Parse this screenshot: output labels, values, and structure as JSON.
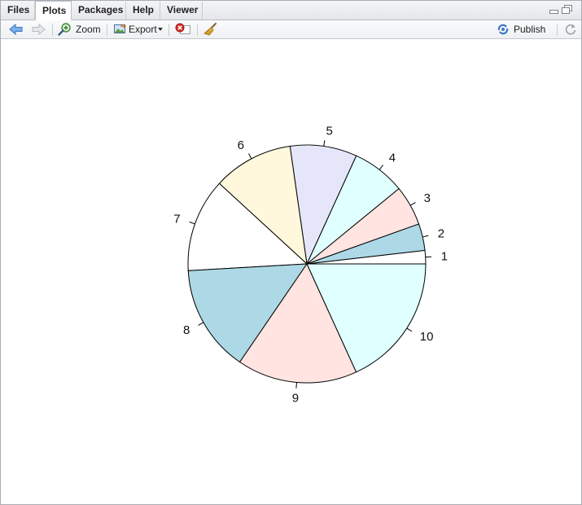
{
  "tabs": [
    {
      "label": "Files"
    },
    {
      "label": "Plots"
    },
    {
      "label": "Packages"
    },
    {
      "label": "Help"
    },
    {
      "label": "Viewer"
    }
  ],
  "active_tab": "Plots",
  "toolbar": {
    "back_icon": "arrow-left-icon",
    "forward_icon": "arrow-right-icon",
    "zoom_label": "Zoom",
    "export_label": "Export",
    "remove_icon": "remove-plot-icon",
    "clear_icon": "broom-icon",
    "publish_label": "Publish",
    "refresh_icon": "refresh-icon"
  },
  "colors": {
    "slices": [
      "#ffffff",
      "#add8e6",
      "#ffe4e1",
      "#e0ffff",
      "#e6e6fa",
      "#fff8dc",
      "#ffffff",
      "#add8e6",
      "#ffe4e1",
      "#e0ffff"
    ],
    "accent": "#3a78c3"
  },
  "chart_data": {
    "type": "pie",
    "title": "",
    "categories": [
      "1",
      "2",
      "3",
      "4",
      "5",
      "6",
      "7",
      "8",
      "9",
      "10"
    ],
    "values": [
      1,
      2,
      3,
      4,
      5,
      6,
      7,
      8,
      9,
      10
    ],
    "start": "3 o'clock",
    "direction": "counter-clockwise",
    "legend": "none"
  }
}
